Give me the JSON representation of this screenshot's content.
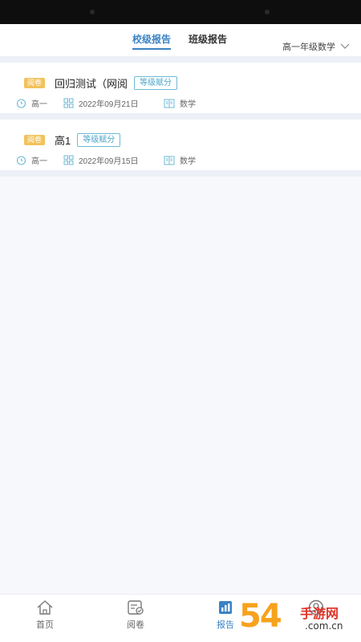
{
  "header": {
    "tabs": [
      {
        "label": "校级报告"
      },
      {
        "label": "班级报告"
      }
    ],
    "grade_subject": "高一年级数学"
  },
  "reports": [
    {
      "tag": "阅卷",
      "title": "回归测试（网阅",
      "level_tag": "等级赋分",
      "grade": "高一",
      "date": "2022年09月21日",
      "subject": "数学"
    },
    {
      "tag": "阅卷",
      "title": "高1",
      "level_tag": "等级赋分",
      "grade": "高一",
      "date": "2022年09月15日",
      "subject": "数学"
    }
  ],
  "tabbar": [
    {
      "label": "首页",
      "icon": "home-icon"
    },
    {
      "label": "阅卷",
      "icon": "exam-icon"
    },
    {
      "label": "报告",
      "icon": "report-icon"
    },
    {
      "label": "",
      "icon": "user-icon"
    }
  ],
  "watermark": {
    "big": "54",
    "cn": "手游网",
    "com": ".com.cn"
  },
  "colors": {
    "accent": "#3a82c4",
    "pending_tag": "#f2c25c",
    "level_tag": "#4ba6c9"
  }
}
